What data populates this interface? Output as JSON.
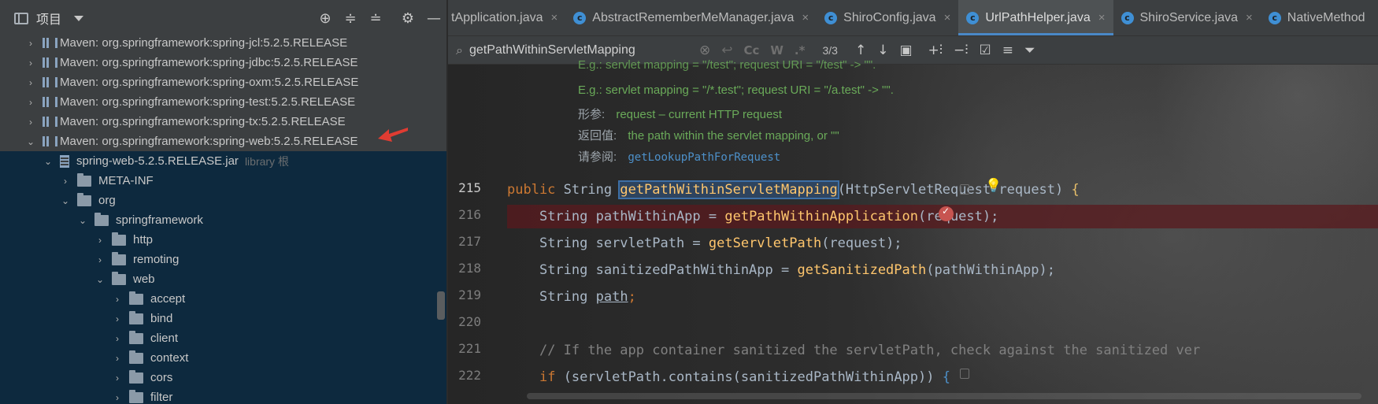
{
  "project_panel": {
    "title": "项目",
    "tools": [
      "locate-icon",
      "expand-all-icon",
      "collapse-all-icon",
      "gear-icon",
      "minimize-icon"
    ],
    "tree": [
      {
        "label": "Maven: org.springframework:spring-jcl:5.2.5.RELEASE",
        "type": "library",
        "expanded": false
      },
      {
        "label": "Maven: org.springframework:spring-jdbc:5.2.5.RELEASE",
        "type": "library",
        "expanded": false
      },
      {
        "label": "Maven: org.springframework:spring-oxm:5.2.5.RELEASE",
        "type": "library",
        "expanded": false
      },
      {
        "label": "Maven: org.springframework:spring-test:5.2.5.RELEASE",
        "type": "library",
        "expanded": false
      },
      {
        "label": "Maven: org.springframework:spring-tx:5.2.5.RELEASE",
        "type": "library",
        "expanded": false
      },
      {
        "label": "Maven: org.springframework:spring-web:5.2.5.RELEASE",
        "type": "library",
        "expanded": true
      },
      {
        "label": "spring-web-5.2.5.RELEASE.jar",
        "suffix": "library 根",
        "type": "jar",
        "expanded": true
      },
      {
        "label": "META-INF",
        "type": "folder",
        "expanded": false
      },
      {
        "label": "org",
        "type": "folder",
        "expanded": true
      },
      {
        "label": "springframework",
        "type": "folder",
        "expanded": true
      },
      {
        "label": "http",
        "type": "folder",
        "expanded": false
      },
      {
        "label": "remoting",
        "type": "folder",
        "expanded": false
      },
      {
        "label": "web",
        "type": "folder",
        "expanded": true
      },
      {
        "label": "accept",
        "type": "folder",
        "expanded": false
      },
      {
        "label": "bind",
        "type": "folder",
        "expanded": false
      },
      {
        "label": "client",
        "type": "folder",
        "expanded": false
      },
      {
        "label": "context",
        "type": "folder",
        "expanded": false
      },
      {
        "label": "cors",
        "type": "folder",
        "expanded": false
      },
      {
        "label": "filter",
        "type": "folder",
        "expanded": false
      }
    ]
  },
  "tabs": [
    {
      "label": "tApplication.java",
      "icon": "",
      "active": false
    },
    {
      "label": "AbstractRememberMeManager.java",
      "icon": "class-icon",
      "active": false
    },
    {
      "label": "ShiroConfig.java",
      "icon": "class-icon",
      "active": false
    },
    {
      "label": "UrlPathHelper.java",
      "icon": "class-icon",
      "active": true
    },
    {
      "label": "ShiroService.java",
      "icon": "class-icon",
      "active": false
    },
    {
      "label": "NativeMethod",
      "icon": "class-icon",
      "active": false
    }
  ],
  "find_bar": {
    "query": "getPathWithinServletMapping",
    "match_count": "3/3",
    "option_labels": [
      "Cc",
      "W",
      ".*"
    ]
  },
  "doc": {
    "lines": [
      "E.g.: servlet mapping = \"/test\"; request URI = \"/test\" -> \"\".",
      "E.g.: servlet mapping = \"/*.test\"; request URI = \"/a.test\" -> \"\"."
    ],
    "params_key": "形参:",
    "params_value": "request – current HTTP request",
    "returns_key": "返回值:",
    "returns_value": "the path within the servlet mapping, or \"\"",
    "see_key": "请参阅:",
    "see_value": "getLookupPathForRequest"
  },
  "code": {
    "line_numbers": [
      "215",
      "216",
      "217",
      "218",
      "219",
      "220",
      "221",
      "222"
    ],
    "l215": {
      "kw": "public",
      "type": "String",
      "name": "getPathWithinServletMapping",
      "params": "(HttpServletRequest request)",
      "brace": "{"
    },
    "l216": {
      "indent": "String pathWithinApp = ",
      "call": "getPathWithinApplication",
      "args": "(request);"
    },
    "l217": {
      "indent": "String servletPath = ",
      "call": "getServletPath",
      "args": "(request);"
    },
    "l218": {
      "indent": "String sanitizedPathWithinApp = ",
      "call": "getSanitizedPath",
      "args": "(pathWithinApp);"
    },
    "l219": {
      "type": "String ",
      "var": "path",
      "end": ";"
    },
    "l221": {
      "comment": "// If the app container sanitized the servletPath, check against the sanitized ver"
    },
    "l222": {
      "kw": "if",
      "cond": "(servletPath.contains(sanitizedPathWithinApp))",
      "brace": "{"
    }
  }
}
